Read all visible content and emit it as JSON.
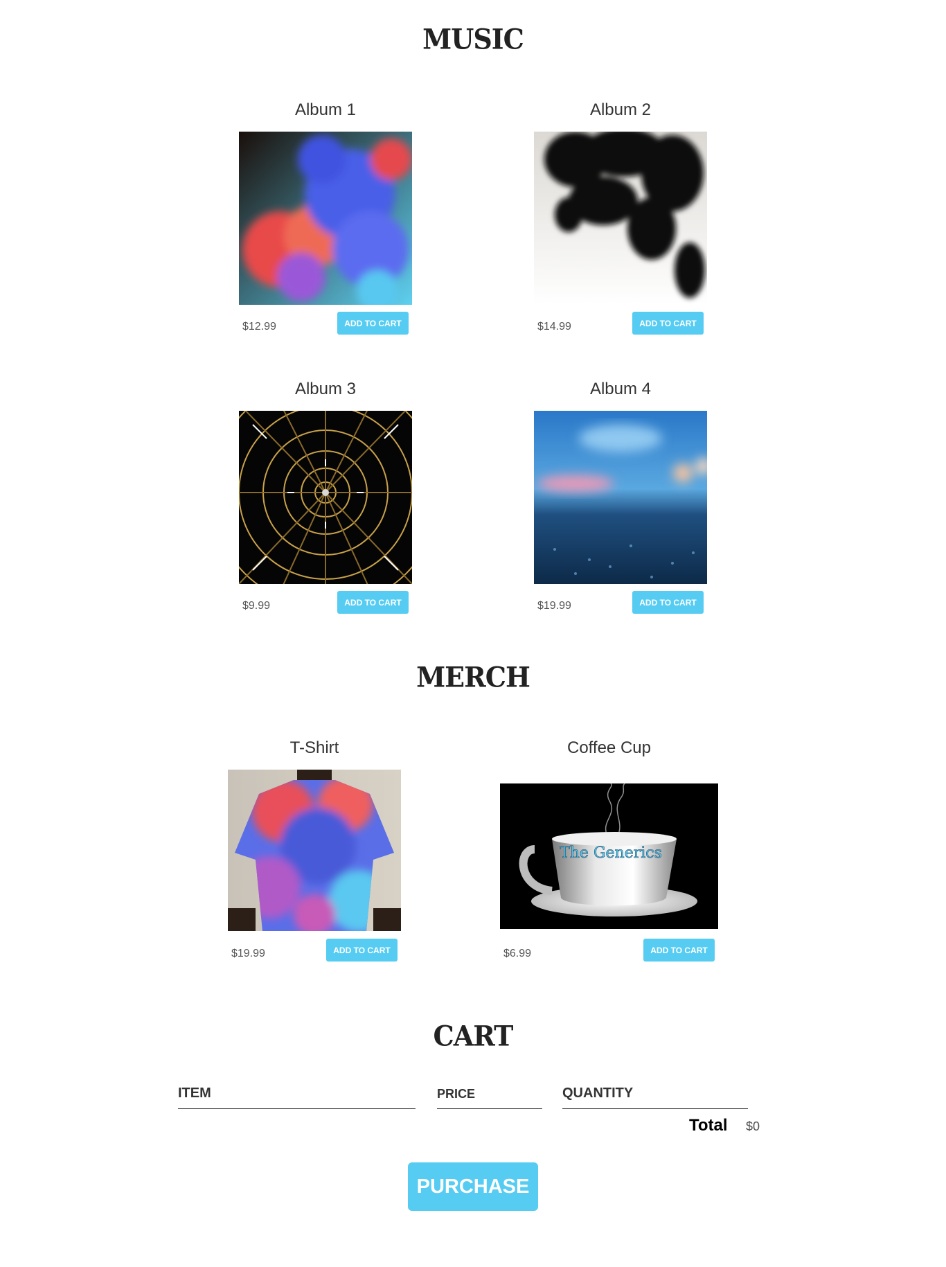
{
  "music": {
    "title": "MUSIC",
    "items": [
      {
        "title": "Album 1",
        "price": "$12.99",
        "button": "ADD TO CART",
        "image": "colorful-smoke-album-art"
      },
      {
        "title": "Album 2",
        "price": "$14.99",
        "button": "ADD TO CART",
        "image": "black-ink-album-art"
      },
      {
        "title": "Album 3",
        "price": "$9.99",
        "button": "ADD TO CART",
        "image": "radial-tunnel-album-art"
      },
      {
        "title": "Album 4",
        "price": "$19.99",
        "button": "ADD TO CART",
        "image": "blue-bokeh-album-art"
      }
    ]
  },
  "merch": {
    "title": "MERCH",
    "items": [
      {
        "title": "T-Shirt",
        "price": "$19.99",
        "button": "ADD TO CART",
        "image": "smoke-tshirt"
      },
      {
        "title": "Coffee Cup",
        "price": "$6.99",
        "button": "ADD TO CART",
        "image": "coffee-cup",
        "cup_text": "The Generics"
      }
    ]
  },
  "cart": {
    "title": "CART",
    "headers": {
      "item": "ITEM",
      "price": "PRICE",
      "quantity": "QUANTITY"
    },
    "total_label": "Total",
    "total_value": "$0",
    "purchase_button": "PURCHASE"
  },
  "colors": {
    "accent": "#56CCF2",
    "text": "#333333"
  }
}
